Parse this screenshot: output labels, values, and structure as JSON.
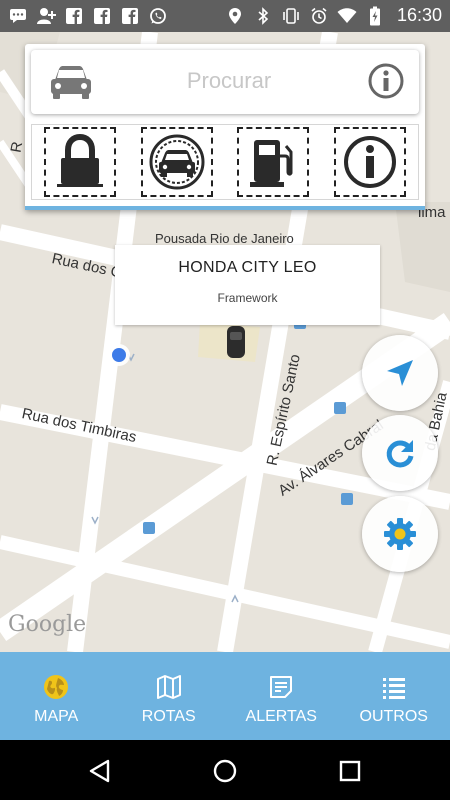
{
  "status_bar": {
    "time": "16:30",
    "left_icons": [
      "chat-icon",
      "add-user-icon",
      "facebook-icon",
      "facebook-icon",
      "facebook-icon",
      "whatsapp-icon"
    ],
    "right_icons": [
      "location-icon",
      "bluetooth-icon",
      "vibrate-icon",
      "alarm-icon",
      "wifi-icon",
      "battery-icon"
    ]
  },
  "search": {
    "placeholder": "Procurar",
    "left_icon": "car-icon",
    "right_icon": "info-icon"
  },
  "quick_actions": [
    {
      "icon": "lock-icon"
    },
    {
      "icon": "car-circle-icon"
    },
    {
      "icon": "fuel-pump-icon"
    },
    {
      "icon": "info-icon"
    }
  ],
  "map": {
    "labels": {
      "pousada": "Pousada Rio de Janeiro",
      "rua_dos": "Rua dos C",
      "rua_timbiras": "Rua dos Timbiras",
      "espirito_santo": "R. Espírito Santo",
      "alvares_cabral": "Av. Álvares Cabral",
      "bahia": "da Bahia",
      "lima": "lima",
      "r_left": "R"
    },
    "google": "Google"
  },
  "info_window": {
    "title": "HONDA CITY LEO",
    "subtitle": "Framework"
  },
  "fabs": [
    {
      "icon": "navigation-arrow-icon"
    },
    {
      "icon": "refresh-icon"
    },
    {
      "icon": "settings-gear-icon"
    }
  ],
  "bottom_nav": [
    {
      "label": "MAPA",
      "icon": "globe-icon",
      "active": true
    },
    {
      "label": "ROTAS",
      "icon": "map-icon",
      "active": false
    },
    {
      "label": "ALERTAS",
      "icon": "alert-note-icon",
      "active": false
    },
    {
      "label": "OUTROS",
      "icon": "list-icon",
      "active": false
    }
  ],
  "colors": {
    "accent": "#6eb3e0",
    "active_icon": "#f0c419",
    "fab_icon": "#2a8fd6",
    "map_bg": "#e8e4dc",
    "status_bar": "#5f5f5f"
  }
}
